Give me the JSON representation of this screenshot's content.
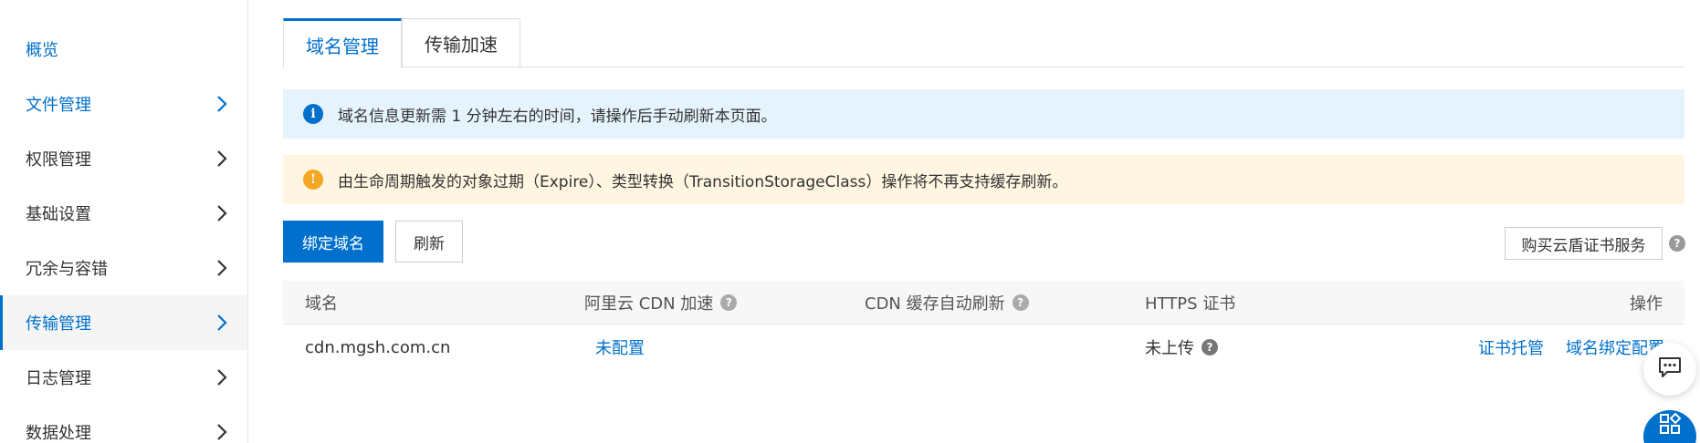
{
  "sidebar": {
    "items": [
      {
        "label": "概览",
        "has_arrow": false
      },
      {
        "label": "文件管理",
        "has_arrow": true
      },
      {
        "label": "权限管理",
        "has_arrow": true
      },
      {
        "label": "基础设置",
        "has_arrow": true
      },
      {
        "label": "冗余与容错",
        "has_arrow": true
      },
      {
        "label": "传输管理",
        "has_arrow": true,
        "active": true
      },
      {
        "label": "日志管理",
        "has_arrow": true
      },
      {
        "label": "数据处理",
        "has_arrow": true
      }
    ]
  },
  "tabs": [
    {
      "label": "域名管理",
      "active": true
    },
    {
      "label": "传输加速",
      "active": false
    }
  ],
  "alerts": {
    "info": "域名信息更新需 1 分钟左右的时间，请操作后手动刷新本页面。",
    "warning": "由生命周期触发的对象过期（Expire）、类型转换（TransitionStorageClass）操作将不再支持缓存刷新。"
  },
  "toolbar": {
    "bind_domain": "绑定域名",
    "refresh": "刷新",
    "buy_cert": "购买云盾证书服务"
  },
  "table": {
    "headers": {
      "domain": "域名",
      "cdn": "阿里云 CDN 加速",
      "cdn_refresh": "CDN 缓存自动刷新",
      "https": "HTTPS 证书",
      "actions": "操作"
    },
    "rows": [
      {
        "domain": "cdn.mgsh.com.cn",
        "cdn": "未配置",
        "cdn_refresh": "",
        "https": "未上传",
        "action_cert": "证书托管",
        "action_bind": "域名绑定配置"
      }
    ]
  },
  "colors": {
    "accent": "#0070cc",
    "info_bg": "#e5f3fd",
    "warn_bg": "#fff5e0",
    "warn_icon": "#f5a623"
  },
  "icons": {
    "info": "info-icon",
    "warning": "warning-icon",
    "help": "help-icon",
    "chat": "chat-icon",
    "apps": "apps-icon"
  }
}
